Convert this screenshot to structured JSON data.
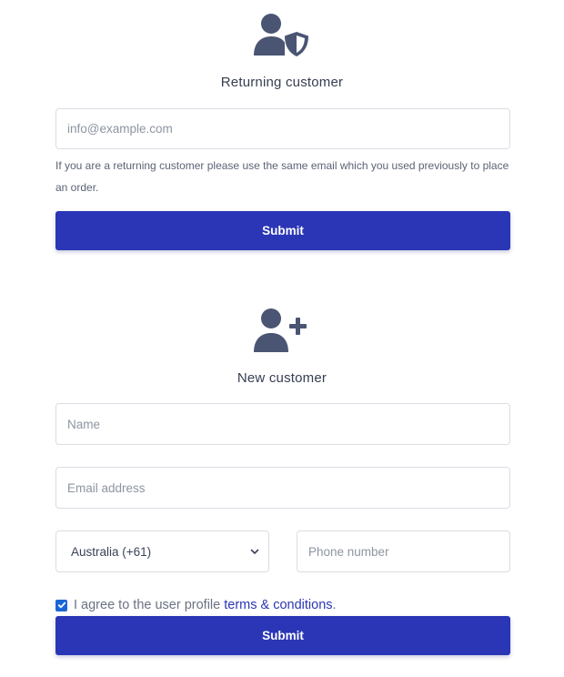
{
  "returning": {
    "heading": "Returning customer",
    "email_placeholder": "info@example.com",
    "hint": "If you are a returning customer please use the same email which you used previously to place an order.",
    "submit_label": "Submit",
    "icon": "user-shield-icon"
  },
  "new_customer": {
    "heading": "New customer",
    "name_placeholder": "Name",
    "email_placeholder": "Email address",
    "country_selected": "Australia (+61)",
    "phone_placeholder": "Phone number",
    "agree_prefix": "I agree to the user profile",
    "terms_link": "terms & conditions",
    "agree_suffix": ".",
    "agree_checked": true,
    "submit_label": "Submit",
    "icon": "user-plus-icon"
  },
  "colors": {
    "primary": "#2a36b5",
    "icon": "#4a5573",
    "checkbox": "#1a66d6"
  }
}
